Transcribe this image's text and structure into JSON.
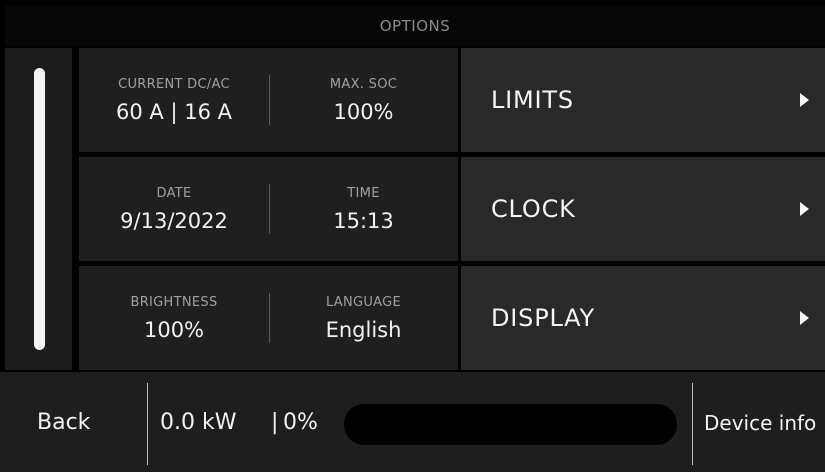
{
  "header": {
    "title": "OPTIONS"
  },
  "scrollbar": {
    "position_fraction": 1.0
  },
  "settings": [
    {
      "left": {
        "label": "CURRENT DC/AC",
        "value": "60 A | 16 A"
      },
      "right": {
        "label": "MAX. SOC",
        "value": "100%"
      },
      "button": {
        "label": "LIMITS"
      }
    },
    {
      "left": {
        "label": "DATE",
        "value": "9/13/2022"
      },
      "right": {
        "label": "TIME",
        "value": "15:13"
      },
      "button": {
        "label": "CLOCK"
      }
    },
    {
      "left": {
        "label": "BRIGHTNESS",
        "value": "100%"
      },
      "right": {
        "label": "LANGUAGE",
        "value": "English"
      },
      "button": {
        "label": "DISPLAY"
      }
    }
  ],
  "footer": {
    "back_label": "Back",
    "power": "0.0 kW",
    "separator": "|",
    "soc": "0%",
    "soc_fraction": 0,
    "device_info_label": "Device info"
  },
  "colors": {
    "background": "#000000",
    "panel": "#1f1f1f",
    "button": "#292929",
    "text": "#f2f2f2",
    "muted": "#a0a0a0"
  }
}
